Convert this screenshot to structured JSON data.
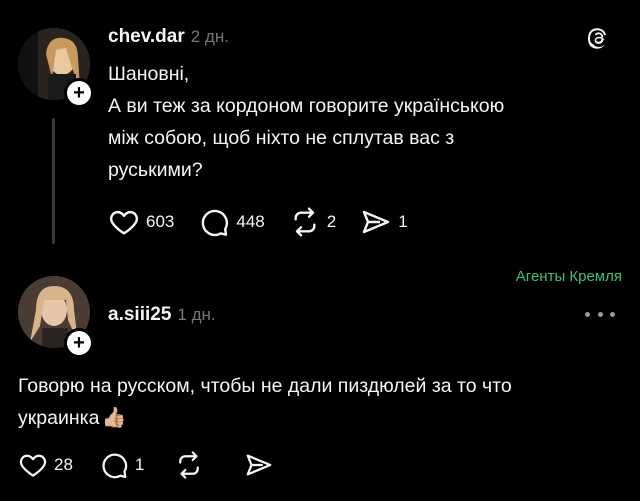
{
  "post": {
    "username": "chev.dar",
    "time": "2 дн.",
    "text_lines": [
      "Шановні,",
      "А ви теж за кордоном говорите українською",
      "між собою, щоб ніхто не сплутав вас з",
      "руськими?"
    ],
    "likes": "603",
    "replies": "448",
    "reposts": "2",
    "shares": "1"
  },
  "tag": "Агенты Кремля",
  "reply": {
    "username": "a.siii25",
    "time": "1 дн.",
    "text_line1": "Говорю на русском, чтобы не дали пиздюлей за то что",
    "text_line2": "украинка",
    "emoji": "👍🏼",
    "likes": "28",
    "replies": "1"
  },
  "icons": {
    "app": "threads-logo-icon",
    "like": "heart-icon",
    "reply": "comment-icon",
    "repost": "repost-icon",
    "share": "send-icon",
    "more": "more-dots-icon",
    "follow": "plus-icon"
  },
  "colors": {
    "background": "#000000",
    "text": "#f3f5f7",
    "muted": "#777777",
    "tag": "#3fbf7f"
  }
}
